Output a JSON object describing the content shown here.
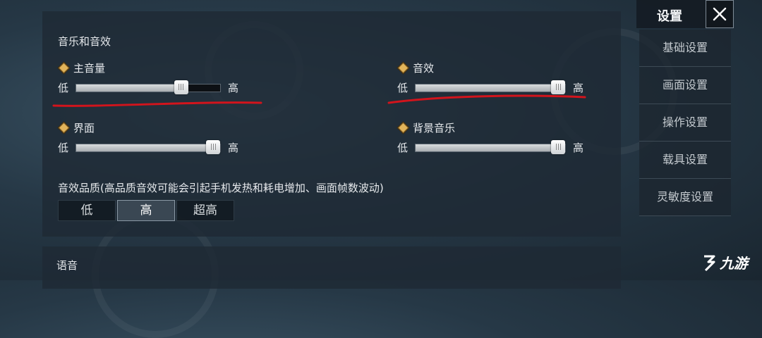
{
  "section_audio": {
    "title": "音乐和音效",
    "low_label": "低",
    "high_label": "高",
    "sliders": {
      "master": {
        "label": "主音量",
        "value_pct": 73
      },
      "sfx": {
        "label": "音效",
        "value_pct": 100
      },
      "ui": {
        "label": "界面",
        "value_pct": 100
      },
      "bgm": {
        "label": "背景音乐",
        "value_pct": 100
      }
    }
  },
  "quality": {
    "label": "音效品质(高品质音效可能会引起手机发热和耗电增加、画面帧数波动)",
    "options": [
      "低",
      "高",
      "超高"
    ],
    "selected": "高"
  },
  "section_voice": {
    "title": "语音"
  },
  "sidebar": {
    "title": "设置",
    "items": [
      "基础设置",
      "画面设置",
      "操作设置",
      "载具设置",
      "灵敏度设置"
    ]
  },
  "watermark": {
    "text": "九游"
  },
  "colors": {
    "accent_gold": "#e2b45a",
    "annotation_red": "#d2141c"
  }
}
